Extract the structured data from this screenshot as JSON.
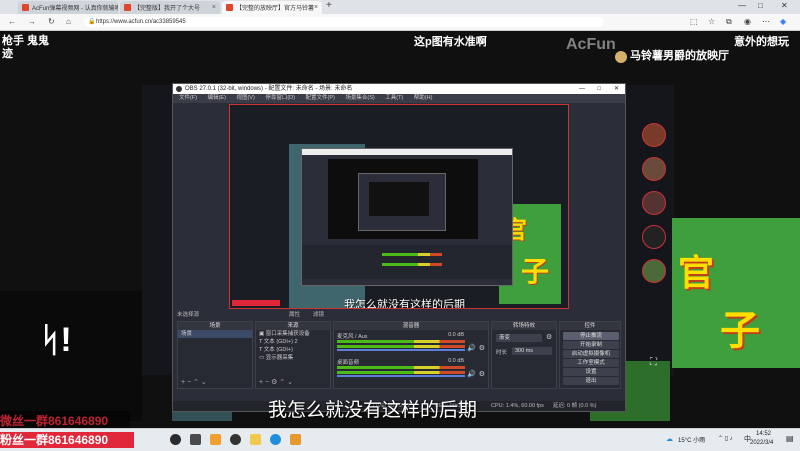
{
  "browser": {
    "tabs": [
      {
        "label": "AcFun弹幕视频网 - 认真你就输啦",
        "active": false
      },
      {
        "label": "【完整版】我开了个大号",
        "active": false
      },
      {
        "label": "【完整的放映厅】官方马铃薯",
        "active": true
      }
    ],
    "new_tab": "+",
    "url": "https://www.acfun.cn/ac33859545",
    "window_min": "—",
    "window_max": "□",
    "window_close": "✕"
  },
  "stream": {
    "top_left_line1": "枪手 鬼鬼",
    "top_left_line2": "迹",
    "top_center": "这p图有水准啊",
    "top_right": "意外的想玩",
    "channel_name": "马铃薯男爵的放映厅",
    "acfun_logo": "AcFun",
    "subtitle": "我怎么就没有这样的后期",
    "subtitle_inner": "我怎么就没有这样的后期",
    "red_overlay_line1": "微丝一群861646890",
    "red_overlay_line2": "粉丝一群861646890"
  },
  "obs": {
    "title": "OBS 27.0.1 (32-bit, windows) - 配置文件: 未命名 - 场景: 未命名",
    "menu": [
      "文件(F)",
      "编辑(E)",
      "视图(V)",
      "停靠窗口(D)",
      "配置文件(P)",
      "场景集合(S)",
      "工具(T)",
      "帮助(H)"
    ],
    "no_source": "未选择源",
    "properties": "属性",
    "filters": "滤镜",
    "docks": {
      "scenes_title": "场景",
      "scenes": [
        "场景"
      ],
      "sources_title": "来源",
      "sources": [
        "窗口采集捕获设备",
        "文本 (GDI+) 2",
        "文本 (GDI+)",
        "显示器采集"
      ],
      "mixer_title": "混音器",
      "mixer": [
        {
          "name": "麦克风 / Aux",
          "level": "0.0 dB"
        },
        {
          "name": "桌面音频",
          "level": "0.0 dB"
        }
      ],
      "transitions_title": "转场特效",
      "transition": "渐变",
      "duration_label": "时长",
      "duration": "300 ms",
      "controls_title": "控件",
      "controls": [
        "停止推流",
        "开始录制",
        "启动虚拟摄像机",
        "工作室模式",
        "设置",
        "退出"
      ]
    },
    "status": {
      "live": "LIVE: 00:00:00",
      "rec": "REC: 00:00:00",
      "cpu": "CPU: 1.4%, 60.00 fps",
      "stats": "延迟: 0 帧 (0.0 %)"
    }
  },
  "taskbar": {
    "weather": "15°C 小雨",
    "time": "14:52",
    "date": "2022/3/4",
    "input": "中"
  },
  "colors": {
    "obs_bg": "#2b2e38",
    "poster_green": "#3f9f3c",
    "poster_yellow": "#ffde00",
    "red_overlay": "#e0283a"
  }
}
